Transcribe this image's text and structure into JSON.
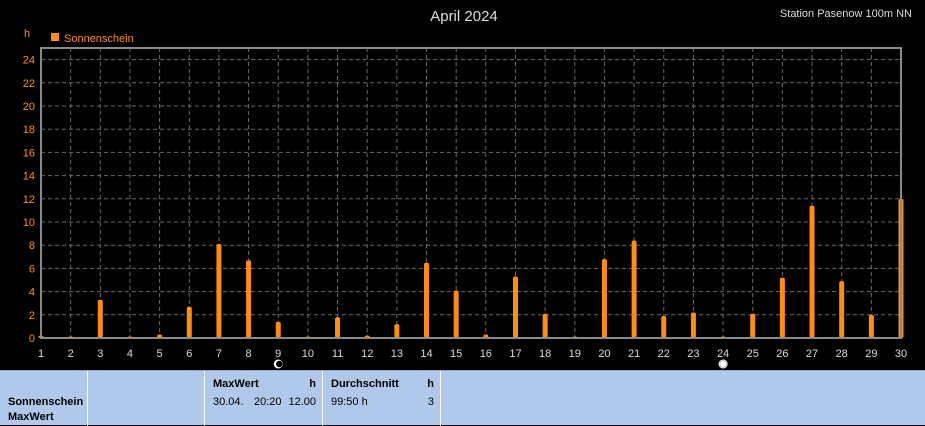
{
  "chart_data": {
    "type": "bar",
    "title": "April 2024",
    "station": "Station Pasenow 100m NN",
    "ylabel": "h",
    "ylim": [
      0,
      25
    ],
    "yticks": [
      0,
      2,
      4,
      6,
      8,
      10,
      12,
      14,
      16,
      18,
      20,
      22,
      24
    ],
    "grid": true,
    "legend_position": "top-left",
    "series": [
      {
        "name": "Sonnenschein",
        "color": "#ff8c1a",
        "categories": [
          1,
          2,
          3,
          4,
          5,
          6,
          7,
          8,
          9,
          10,
          11,
          12,
          13,
          14,
          15,
          16,
          17,
          18,
          19,
          20,
          21,
          22,
          23,
          24,
          25,
          26,
          27,
          28,
          29,
          30
        ],
        "values": [
          0.2,
          0.1,
          3.3,
          0.0,
          0.3,
          2.7,
          8.1,
          6.7,
          1.4,
          0.1,
          1.8,
          0.2,
          1.2,
          6.5,
          4.1,
          0.3,
          5.3,
          2.1,
          0.0,
          6.8,
          8.4,
          1.9,
          2.2,
          0.0,
          2.1,
          5.2,
          11.4,
          4.9,
          2.0,
          12.0
        ]
      }
    ],
    "moon_phase_markers": [
      {
        "day": 9,
        "icon": "new-moon-icon"
      },
      {
        "day": 24,
        "icon": "full-moon-icon"
      }
    ]
  },
  "panel": {
    "row_label_1": "Sonnenschein",
    "row_label_2": "MaxWert",
    "maxwert": {
      "header": "MaxWert",
      "unit": "h",
      "date": "30.04.",
      "time": "20:20",
      "value": "12.00"
    },
    "durchschnitt": {
      "header": "Durchschnitt",
      "unit": "h",
      "total": "99:50 h",
      "value": "3"
    }
  }
}
